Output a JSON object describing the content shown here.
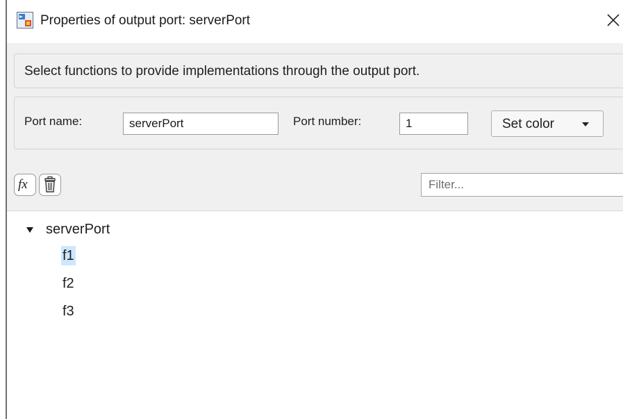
{
  "window": {
    "title": "Properties of output port: serverPort",
    "close_icon": "close-icon",
    "app_icon": "port-properties-icon"
  },
  "description": {
    "text": "Select functions to provide implementations through the output port."
  },
  "port": {
    "name_label": "Port name:",
    "name_value": "serverPort",
    "number_label": "Port number:",
    "number_value": "1",
    "set_color_label": "Set color"
  },
  "toolbar": {
    "add_function_label": "fx",
    "add_function_icon": "fx-icon",
    "delete_icon": "trash-icon",
    "filter_placeholder": "Filter..."
  },
  "tree": {
    "root": {
      "label": "serverPort",
      "expanded": true
    },
    "children": [
      {
        "label": "f1",
        "selected": true
      },
      {
        "label": "f2",
        "selected": false
      },
      {
        "label": "f3",
        "selected": false
      }
    ]
  },
  "colors": {
    "selection": "#cce8ff",
    "panel_background": "#f0f0f0"
  }
}
